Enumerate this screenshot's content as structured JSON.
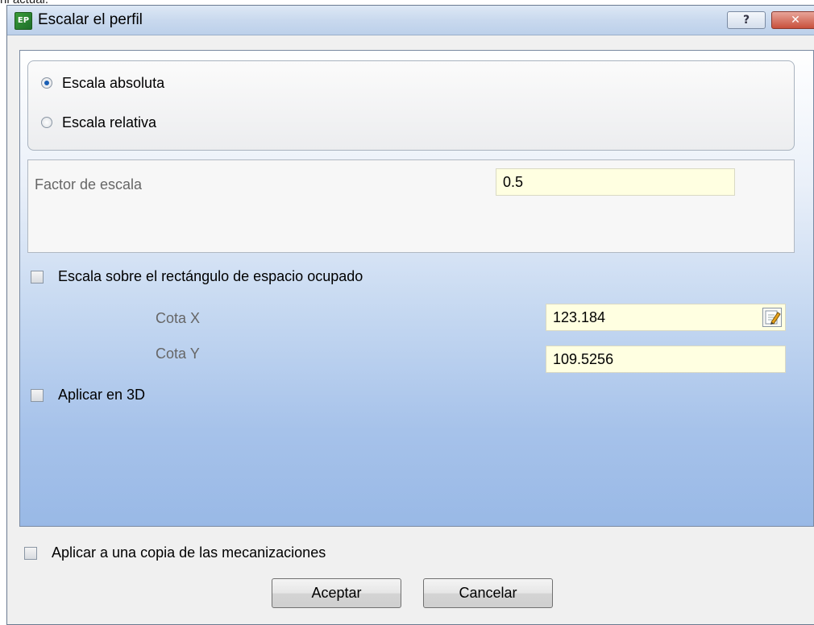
{
  "top_fragment": "nl actual.",
  "window": {
    "title": "Escalar el perfil",
    "help_label": "?",
    "close_label": "✕"
  },
  "scale_mode": {
    "options": [
      {
        "label": "Escala absoluta",
        "checked": true
      },
      {
        "label": "Escala relativa",
        "checked": false
      }
    ]
  },
  "factor": {
    "label": "Factor de escala",
    "value": "0.5"
  },
  "bounding_rect": {
    "checkbox_label": "Escala sobre el rectángulo de espacio ocupado",
    "checked": false,
    "cota_x_label": "Cota X",
    "cota_x_value": "123.184",
    "cota_y_label": "Cota Y",
    "cota_y_value": "109.5256"
  },
  "apply_3d": {
    "label": "Aplicar en 3D",
    "checked": false
  },
  "apply_copy": {
    "label": "Aplicar a una copia de las mecanizaciones",
    "checked": false
  },
  "buttons": {
    "ok": "Aceptar",
    "cancel": "Cancelar"
  },
  "icons": {
    "app": "app-logo-icon",
    "edit": "edit-pencil-icon"
  }
}
